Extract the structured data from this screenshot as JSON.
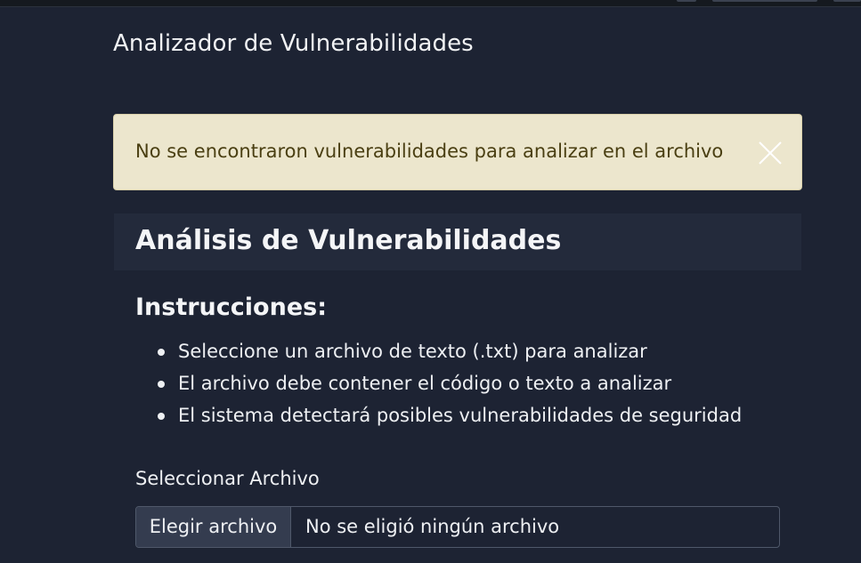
{
  "app": {
    "title": "Analizador de Vulnerabilidades"
  },
  "alert": {
    "message": "No se encontraron vulnerabilidades para analizar en el archivo",
    "close_icon": "close-icon",
    "color": "#ece6cd",
    "text_color": "#4a3f12"
  },
  "card": {
    "title": "Análisis de Vulnerabilidades"
  },
  "instructions": {
    "title": "Instrucciones:",
    "items": [
      "Seleccione un archivo de texto (.txt) para analizar",
      "El archivo debe contener el código o texto a analizar",
      "El sistema detectará posibles vulnerabilidades de seguridad"
    ]
  },
  "file_field": {
    "label": "Seleccionar Archivo",
    "button_label": "Elegir archivo",
    "status": "No se eligió ningún archivo"
  },
  "colors": {
    "background": "#1d2333",
    "card_header": "#232a3b"
  }
}
